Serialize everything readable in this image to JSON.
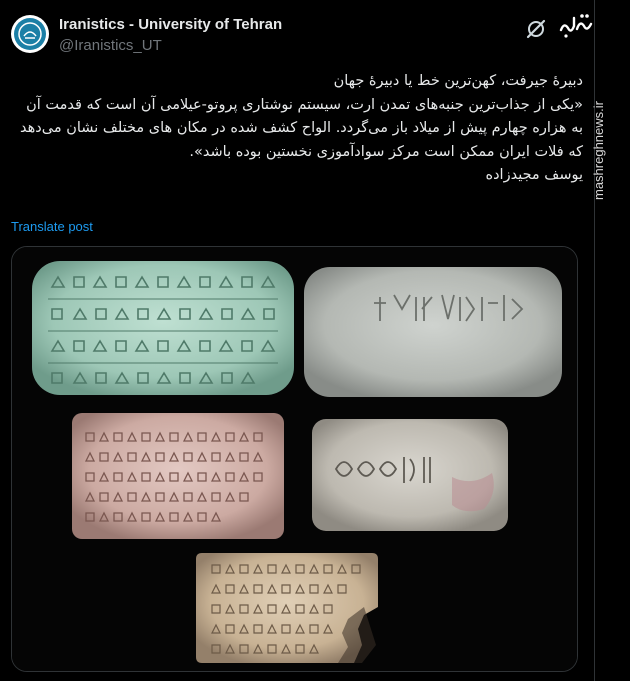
{
  "account": {
    "display_name": "Iranistics - University of Tehran",
    "handle": "@Iranistics_UT",
    "avatar_icon": "university-seal-icon"
  },
  "watermark": {
    "logo_text": "مشرق",
    "vertical_text": "mashreghnews.ir"
  },
  "post": {
    "lines": [
      "دبیرهٔ جیرفت، کهن‌ترین خط یا دبیرهٔ جهان",
      "«یکی از جذاب‌ترین جنبه‌های تمدن ارت، سیستم نوشتاری پروتو-عیلامی آن است که قدمت آن به هزاره چهارم پیش از میلاد باز می‌گردد. الواح کشف شده در مکان های مختلف نشان می‌دهد که فلات ایران ممکن است مرکز سوادآموزی نخستین بوده باشد».",
      "یوسف مجیدزاده"
    ],
    "translate_label": "Translate post"
  },
  "media": {
    "description_icon": "clay-tablets-photo"
  },
  "colors": {
    "background": "#000000",
    "text": "#e7e9ea",
    "secondary": "#71767b",
    "link": "#1d9bf0",
    "border": "#2f3336"
  }
}
